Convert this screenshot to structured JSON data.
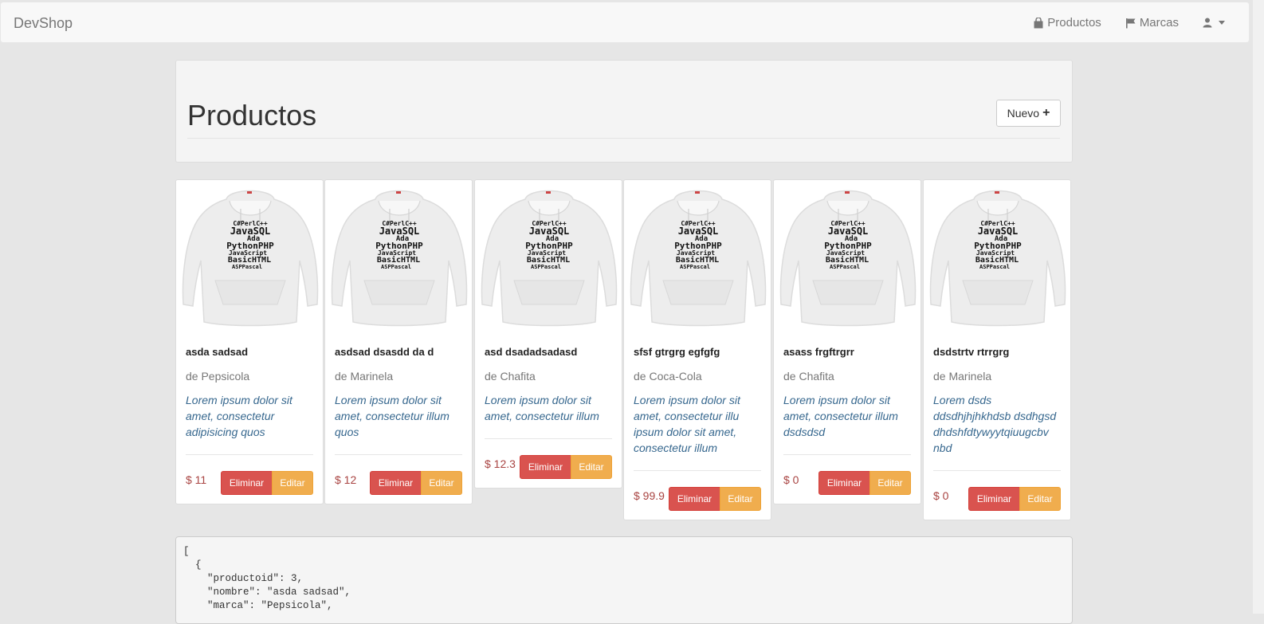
{
  "app": {
    "brand": "DevShop",
    "nav": {
      "productos": "Productos",
      "marcas": "Marcas"
    }
  },
  "page": {
    "title": "Productos",
    "new_button": "Nuevo"
  },
  "products": [
    {
      "name": "asda sadsad",
      "brand": "de Pepsicola",
      "description": "Lorem ipsum dolor sit amet, consectetur adipisicing quos",
      "price": "$ 11",
      "delete_label": "Eliminar",
      "edit_label": "Editar"
    },
    {
      "name": "asdsad dsasdd da d",
      "brand": "de Marinela",
      "description": "Lorem ipsum dolor sit amet, consectetur illum quos",
      "price": "$ 12",
      "delete_label": "Eliminar",
      "edit_label": "Editar"
    },
    {
      "name": "asd dsadadsadasd",
      "brand": "de Chafita",
      "description": "Lorem ipsum dolor sit amet, consectetur illum",
      "price": "$ 12.3",
      "delete_label": "Eliminar",
      "edit_label": "Editar"
    },
    {
      "name": "sfsf gtrgrg egfgfg",
      "brand": "de Coca-Cola",
      "description": "Lorem ipsum dolor sit amet, consectetur illu ipsum dolor sit amet, consectetur illum",
      "price": "$ 99.9",
      "delete_label": "Eliminar",
      "edit_label": "Editar"
    },
    {
      "name": "asass frgftrgrr",
      "brand": "de Chafita",
      "description": "Lorem ipsum dolor sit amet, consectetur illum dsdsdsd",
      "price": "$ 0",
      "delete_label": "Eliminar",
      "edit_label": "Editar"
    },
    {
      "name": "dsdstrtv rtrrgrg",
      "brand": "de Marinela",
      "description": "Lorem dsds ddsdhjhjhkhdsb dsdhgsd dhdshfdtywyytqiuugcbv nbd",
      "price": "$ 0",
      "delete_label": "Eliminar",
      "edit_label": "Editar"
    }
  ],
  "hoodie_words": {
    "row1": [
      "C#",
      "Perl",
      "C++"
    ],
    "row2": [
      "Java",
      "SQL"
    ],
    "row3": [
      "Ada"
    ],
    "row4": [
      "Python",
      "PHP"
    ],
    "row5": [
      "JavaScript"
    ],
    "row6": [
      "Basic",
      "HTML"
    ],
    "row7": [
      "ASP",
      "Pascal"
    ]
  },
  "json_preview": "[\n  {\n    \"productoid\": 3,\n    \"nombre\": \"asda sadsad\",\n    \"marca\": \"Pepsicola\","
}
